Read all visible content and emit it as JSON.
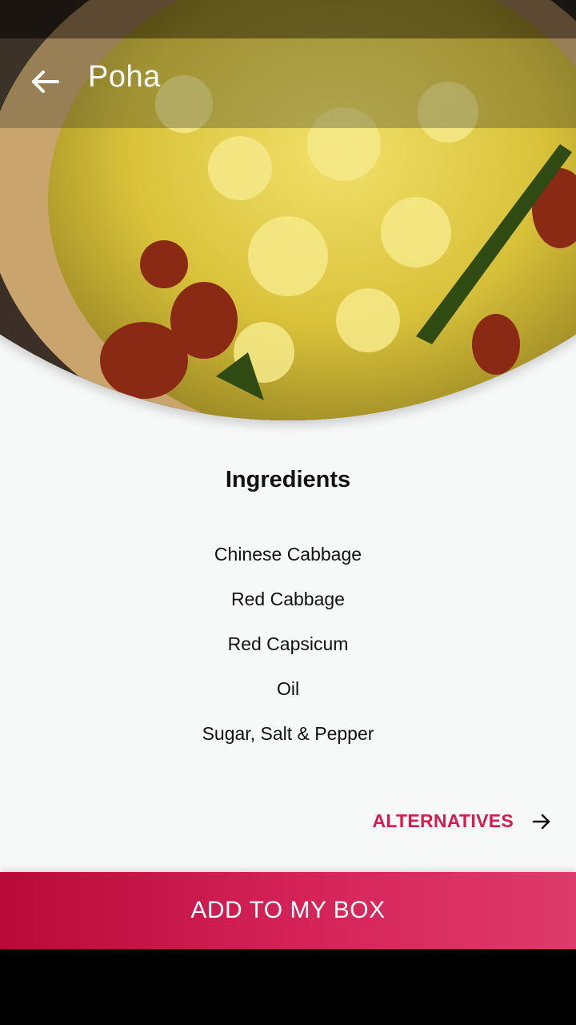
{
  "app_bar": {
    "title": "Poha",
    "back_icon": "arrow-left-icon"
  },
  "hero": {
    "description_icon": "food-photo"
  },
  "ingredients": {
    "title": "Ingredients",
    "items": [
      "Chinese Cabbage",
      "Red Cabbage",
      "Red Capsicum",
      "Oil",
      "Sugar, Salt & Pepper"
    ]
  },
  "alternatives": {
    "label": "ALTERNATIVES",
    "icon": "arrow-right-icon"
  },
  "cta": {
    "label": "ADD TO MY BOX"
  },
  "colors": {
    "accent": "#d81b4e",
    "cta_start": "#b80a3a",
    "cta_end": "#de3a6c",
    "background": "#f7f9f9"
  }
}
